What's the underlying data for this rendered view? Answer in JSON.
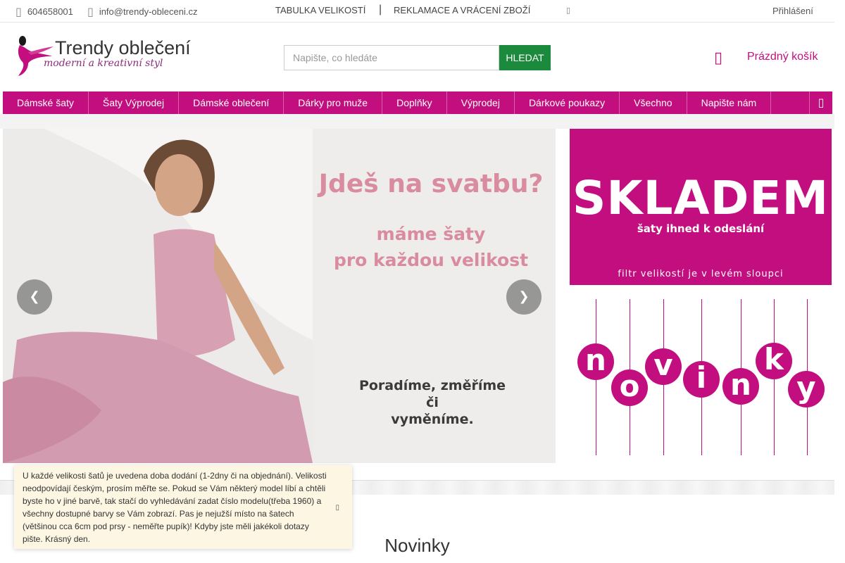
{
  "topbar": {
    "phone": "604658001",
    "email": "info@trendy-obleceni.cz",
    "links": [
      "TABULKA VELIKOSTÍ",
      "REKLAMACE A VRÁCENÍ ZBOŽÍ"
    ],
    "separator": "|",
    "login": "Přihlášení",
    "icons": {
      "phone": "phone-icon",
      "email": "email-icon",
      "extra": "dropdown-icon"
    }
  },
  "header": {
    "logo_title": "Trendy oblečení",
    "logo_subtitle": "moderní a kreativní styl",
    "search": {
      "placeholder": "Napište, co hledáte",
      "button": "HLEDAT"
    },
    "cart_label": "Prázdný košík"
  },
  "nav": {
    "items": [
      "Dámské šaty",
      "Šaty Výprodej",
      "Dámské oblečení",
      "Dárky pro muže",
      "Doplňky",
      "Výprodej",
      "Dárkové poukazy",
      "Všechno",
      "Napište nám"
    ],
    "toggle_icon": "menu-toggle-icon"
  },
  "slider": {
    "headline": "Jdeš na svatbu?",
    "sub_line1": "máme šaty",
    "sub_line2": "pro každou velikost",
    "cta_line1": "Poradíme, změříme",
    "cta_line2": "či",
    "cta_line3": "vyměníme.",
    "prev_icon": "chevron-left-icon",
    "next_icon": "chevron-right-icon"
  },
  "banner_stock": {
    "title": "SKLADEM",
    "subtitle": "šaty ihned k odeslání",
    "note": "filtr velikostí je v levém sloupci"
  },
  "banner_new": {
    "letters": [
      "n",
      "o",
      "v",
      "i",
      "n",
      "k",
      "y"
    ]
  },
  "section": {
    "title": "Novinky"
  },
  "notice": {
    "text": "U každé velikosti šatů je uvedena doba dodání (1-2dny či na objednání). Velikosti neodpovídají českým, prosím měřte se. Pokud se Vám některý model líbí a chtěli byste ho v jiné barvě, tak stačí do vyhledávání zadat číslo modelu(třeba 1960) a všechny dostupné barvy se Vám zobrazí. Pas je nejužší místo na šatech (většinou cca 6cm pod prsy - neměřte pupík)! Kdyby jste měli jakékoli dotazy pište. Krásný den."
  },
  "colors": {
    "brand": "#c20e7e",
    "search_button": "#1c8a3c",
    "slide_text": "#d98ba0"
  }
}
